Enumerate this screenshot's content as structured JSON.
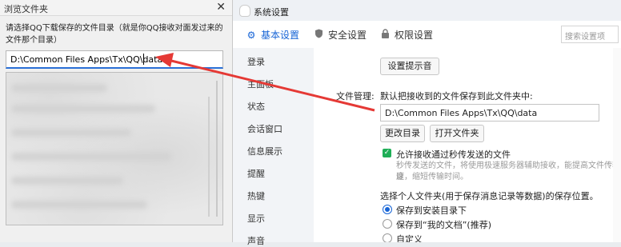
{
  "browse_dialog": {
    "title": "浏览文件夹",
    "close_icon": "✕",
    "description": "请选择QQ下载保存的文件目录（就是你QQ接收对面发过来的文件那个目录）",
    "path_value": "D:\\Common Files Apps\\Tx\\QQ\\data"
  },
  "settings": {
    "window_title": "系统设置",
    "tabs": [
      {
        "icon": "gear-icon",
        "label": "基本设置",
        "active": true
      },
      {
        "icon": "shield-icon",
        "label": "安全设置",
        "active": false
      },
      {
        "icon": "lock-icon",
        "label": "权限设置",
        "active": false
      }
    ],
    "search_placeholder": "搜索设置项",
    "sidebar": [
      "登录",
      "主面板",
      "状态",
      "会话窗口",
      "信息展示",
      "提醒",
      "热键",
      "显示",
      "声音"
    ],
    "content": {
      "set_prompt_button": "设置提示音",
      "file_mgmt_label": "文件管理:",
      "default_save_text": "默认把接收到的文件保存到此文件夹中:",
      "path_value": "D:\\Common Files Apps\\Tx\\QQ\\data",
      "change_dir_button": "更改目录",
      "open_folder_button": "打开文件夹",
      "allow_sec_transfer": "允许接收通过秒传发送的文件",
      "sec_transfer_desc_1": "秒传发送的文件，将使用极速服务器辅助接收，能提高文件传输速",
      "sec_transfer_desc_2": "度，缩短传输时间。",
      "personal_folder_text": "选择个人文件夹(用于保存消息记录等数据)的保存位置。",
      "radio_options": [
        {
          "label": "保存到安装目录下",
          "selected": true
        },
        {
          "label": "保存到“我的文档”(推荐)",
          "selected": false
        },
        {
          "label": "自定义",
          "selected": false
        }
      ]
    }
  },
  "accent_colors": {
    "arrow": "#e53935",
    "active_tab": "#1664d6",
    "check": "#1fae57"
  }
}
